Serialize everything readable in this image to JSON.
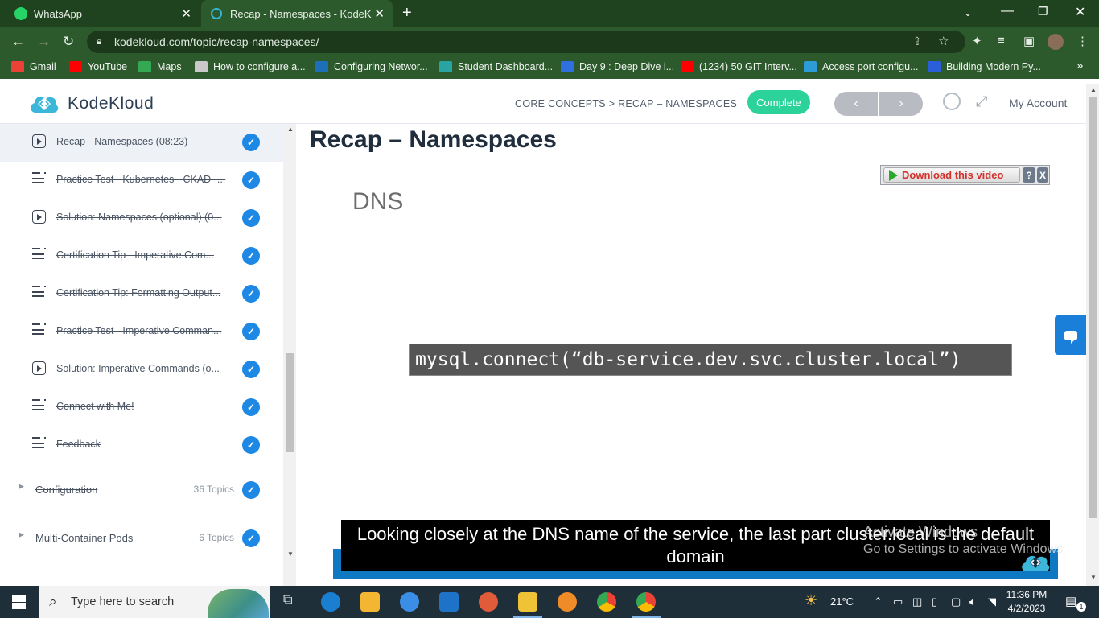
{
  "browser": {
    "tabs": [
      {
        "title": "WhatsApp",
        "icon": "whatsapp-icon"
      },
      {
        "title": "Recap - Namespaces - KodeKloud",
        "icon": "kodekloud-icon"
      }
    ],
    "new_tab": "+",
    "url": "kodekloud.com/topic/recap-namespaces/",
    "bookmarks": [
      {
        "label": "Gmail",
        "color": "#ea4335"
      },
      {
        "label": "YouTube",
        "color": "#ff0000"
      },
      {
        "label": "Maps",
        "color": "#34a853"
      },
      {
        "label": "How to configure a...",
        "color": "#c9c9c9"
      },
      {
        "label": "Configuring Networ...",
        "color": "#1f6fb8"
      },
      {
        "label": "Student Dashboard...",
        "color": "#2aa3a3"
      },
      {
        "label": "Day 9 : Deep Dive i...",
        "color": "#2f6fdf"
      },
      {
        "label": "(1234) 50 GIT Interv...",
        "color": "#ff0000"
      },
      {
        "label": "Access port configu...",
        "color": "#2c9bd6"
      },
      {
        "label": "Building Modern Py...",
        "color": "#2b5fd9"
      }
    ],
    "bookmarks_more": "»"
  },
  "header": {
    "logo_text": "KodeKloud",
    "breadcrumb": "CORE CONCEPTS > RECAP – NAMESPACES",
    "complete_label": "Complete",
    "prev_label": "‹",
    "next_label": "›",
    "account_label": "My Account"
  },
  "sidebar": {
    "lessons": [
      {
        "label": "Recap - Namespaces (08:23)",
        "type": "video",
        "active": true
      },
      {
        "label": "Practice Test - Kubernetes - CKAD -...",
        "type": "doc"
      },
      {
        "label": "Solution: Namespaces (optional) (0...",
        "type": "video"
      },
      {
        "label": "Certification Tip - Imperative Com...",
        "type": "doc"
      },
      {
        "label": "Certification Tip: Formatting Output...",
        "type": "doc"
      },
      {
        "label": "Practice Test - Imperative Comman...",
        "type": "doc"
      },
      {
        "label": "Solution: Imperative Commands (o...",
        "type": "video"
      },
      {
        "label": "Connect with Me!",
        "type": "doc"
      },
      {
        "label": "Feedback",
        "type": "doc"
      }
    ],
    "sections": [
      {
        "name": "Configuration",
        "count": "36 Topics"
      },
      {
        "name": "Multi-Container Pods",
        "count": "6 Topics"
      }
    ],
    "check_glyph": "✓"
  },
  "main": {
    "title": "Recap – Namespaces",
    "download_label": "Download this video",
    "download_help": "?",
    "download_close": "X",
    "slide_heading": "DNS",
    "code_text": "mysql.connect(“db-service.dev.svc.cluster.local”)",
    "caption": "Looking closely at the DNS name of the service, the last part cluster.local is the default domain",
    "watermark_line1": "Activate Windows",
    "watermark_line2": "Go to Settings to activate Windows"
  },
  "taskbar": {
    "search_placeholder": "Type here to search",
    "temperature": "21°C",
    "time": "11:36 PM",
    "date": "4/2/2023",
    "notification_count": "1"
  }
}
